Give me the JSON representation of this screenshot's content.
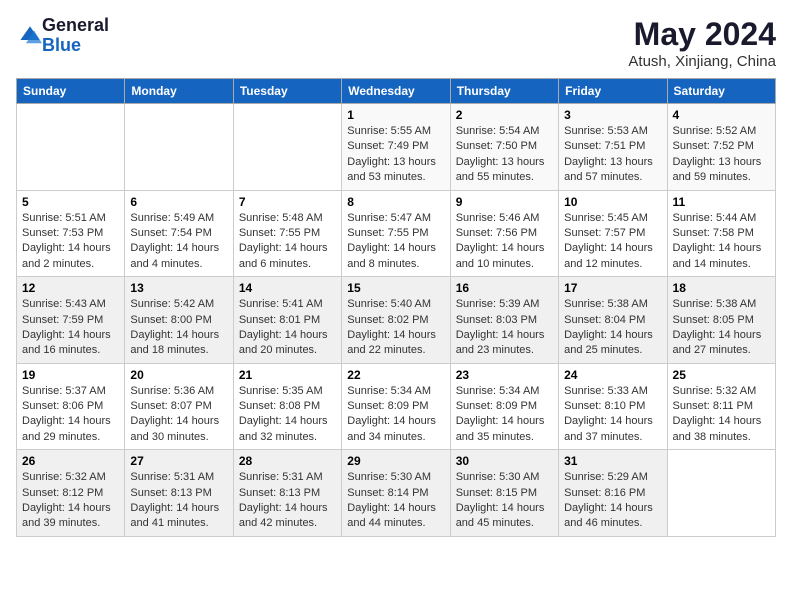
{
  "header": {
    "logo": {
      "general": "General",
      "blue": "Blue"
    },
    "title": "May 2024",
    "location": "Atush, Xinjiang, China"
  },
  "weekdays": [
    "Sunday",
    "Monday",
    "Tuesday",
    "Wednesday",
    "Thursday",
    "Friday",
    "Saturday"
  ],
  "weeks": [
    [
      {
        "day": "",
        "sunrise": "",
        "sunset": "",
        "daylight": ""
      },
      {
        "day": "",
        "sunrise": "",
        "sunset": "",
        "daylight": ""
      },
      {
        "day": "",
        "sunrise": "",
        "sunset": "",
        "daylight": ""
      },
      {
        "day": "1",
        "sunrise": "Sunrise: 5:55 AM",
        "sunset": "Sunset: 7:49 PM",
        "daylight": "Daylight: 13 hours and 53 minutes."
      },
      {
        "day": "2",
        "sunrise": "Sunrise: 5:54 AM",
        "sunset": "Sunset: 7:50 PM",
        "daylight": "Daylight: 13 hours and 55 minutes."
      },
      {
        "day": "3",
        "sunrise": "Sunrise: 5:53 AM",
        "sunset": "Sunset: 7:51 PM",
        "daylight": "Daylight: 13 hours and 57 minutes."
      },
      {
        "day": "4",
        "sunrise": "Sunrise: 5:52 AM",
        "sunset": "Sunset: 7:52 PM",
        "daylight": "Daylight: 13 hours and 59 minutes."
      }
    ],
    [
      {
        "day": "5",
        "sunrise": "Sunrise: 5:51 AM",
        "sunset": "Sunset: 7:53 PM",
        "daylight": "Daylight: 14 hours and 2 minutes."
      },
      {
        "day": "6",
        "sunrise": "Sunrise: 5:49 AM",
        "sunset": "Sunset: 7:54 PM",
        "daylight": "Daylight: 14 hours and 4 minutes."
      },
      {
        "day": "7",
        "sunrise": "Sunrise: 5:48 AM",
        "sunset": "Sunset: 7:55 PM",
        "daylight": "Daylight: 14 hours and 6 minutes."
      },
      {
        "day": "8",
        "sunrise": "Sunrise: 5:47 AM",
        "sunset": "Sunset: 7:55 PM",
        "daylight": "Daylight: 14 hours and 8 minutes."
      },
      {
        "day": "9",
        "sunrise": "Sunrise: 5:46 AM",
        "sunset": "Sunset: 7:56 PM",
        "daylight": "Daylight: 14 hours and 10 minutes."
      },
      {
        "day": "10",
        "sunrise": "Sunrise: 5:45 AM",
        "sunset": "Sunset: 7:57 PM",
        "daylight": "Daylight: 14 hours and 12 minutes."
      },
      {
        "day": "11",
        "sunrise": "Sunrise: 5:44 AM",
        "sunset": "Sunset: 7:58 PM",
        "daylight": "Daylight: 14 hours and 14 minutes."
      }
    ],
    [
      {
        "day": "12",
        "sunrise": "Sunrise: 5:43 AM",
        "sunset": "Sunset: 7:59 PM",
        "daylight": "Daylight: 14 hours and 16 minutes."
      },
      {
        "day": "13",
        "sunrise": "Sunrise: 5:42 AM",
        "sunset": "Sunset: 8:00 PM",
        "daylight": "Daylight: 14 hours and 18 minutes."
      },
      {
        "day": "14",
        "sunrise": "Sunrise: 5:41 AM",
        "sunset": "Sunset: 8:01 PM",
        "daylight": "Daylight: 14 hours and 20 minutes."
      },
      {
        "day": "15",
        "sunrise": "Sunrise: 5:40 AM",
        "sunset": "Sunset: 8:02 PM",
        "daylight": "Daylight: 14 hours and 22 minutes."
      },
      {
        "day": "16",
        "sunrise": "Sunrise: 5:39 AM",
        "sunset": "Sunset: 8:03 PM",
        "daylight": "Daylight: 14 hours and 23 minutes."
      },
      {
        "day": "17",
        "sunrise": "Sunrise: 5:38 AM",
        "sunset": "Sunset: 8:04 PM",
        "daylight": "Daylight: 14 hours and 25 minutes."
      },
      {
        "day": "18",
        "sunrise": "Sunrise: 5:38 AM",
        "sunset": "Sunset: 8:05 PM",
        "daylight": "Daylight: 14 hours and 27 minutes."
      }
    ],
    [
      {
        "day": "19",
        "sunrise": "Sunrise: 5:37 AM",
        "sunset": "Sunset: 8:06 PM",
        "daylight": "Daylight: 14 hours and 29 minutes."
      },
      {
        "day": "20",
        "sunrise": "Sunrise: 5:36 AM",
        "sunset": "Sunset: 8:07 PM",
        "daylight": "Daylight: 14 hours and 30 minutes."
      },
      {
        "day": "21",
        "sunrise": "Sunrise: 5:35 AM",
        "sunset": "Sunset: 8:08 PM",
        "daylight": "Daylight: 14 hours and 32 minutes."
      },
      {
        "day": "22",
        "sunrise": "Sunrise: 5:34 AM",
        "sunset": "Sunset: 8:09 PM",
        "daylight": "Daylight: 14 hours and 34 minutes."
      },
      {
        "day": "23",
        "sunrise": "Sunrise: 5:34 AM",
        "sunset": "Sunset: 8:09 PM",
        "daylight": "Daylight: 14 hours and 35 minutes."
      },
      {
        "day": "24",
        "sunrise": "Sunrise: 5:33 AM",
        "sunset": "Sunset: 8:10 PM",
        "daylight": "Daylight: 14 hours and 37 minutes."
      },
      {
        "day": "25",
        "sunrise": "Sunrise: 5:32 AM",
        "sunset": "Sunset: 8:11 PM",
        "daylight": "Daylight: 14 hours and 38 minutes."
      }
    ],
    [
      {
        "day": "26",
        "sunrise": "Sunrise: 5:32 AM",
        "sunset": "Sunset: 8:12 PM",
        "daylight": "Daylight: 14 hours and 39 minutes."
      },
      {
        "day": "27",
        "sunrise": "Sunrise: 5:31 AM",
        "sunset": "Sunset: 8:13 PM",
        "daylight": "Daylight: 14 hours and 41 minutes."
      },
      {
        "day": "28",
        "sunrise": "Sunrise: 5:31 AM",
        "sunset": "Sunset: 8:13 PM",
        "daylight": "Daylight: 14 hours and 42 minutes."
      },
      {
        "day": "29",
        "sunrise": "Sunrise: 5:30 AM",
        "sunset": "Sunset: 8:14 PM",
        "daylight": "Daylight: 14 hours and 44 minutes."
      },
      {
        "day": "30",
        "sunrise": "Sunrise: 5:30 AM",
        "sunset": "Sunset: 8:15 PM",
        "daylight": "Daylight: 14 hours and 45 minutes."
      },
      {
        "day": "31",
        "sunrise": "Sunrise: 5:29 AM",
        "sunset": "Sunset: 8:16 PM",
        "daylight": "Daylight: 14 hours and 46 minutes."
      },
      {
        "day": "",
        "sunrise": "",
        "sunset": "",
        "daylight": ""
      }
    ]
  ]
}
